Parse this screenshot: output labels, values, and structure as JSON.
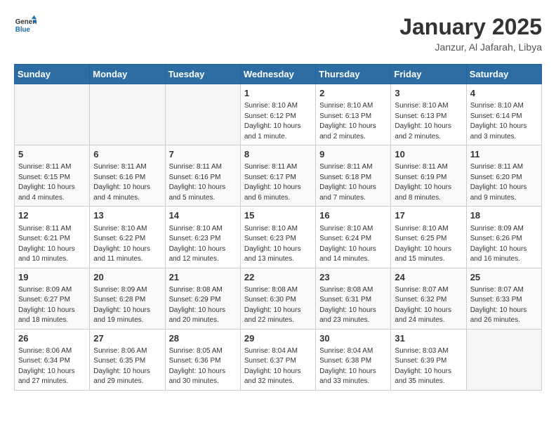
{
  "header": {
    "logo_line1": "General",
    "logo_line2": "Blue",
    "title": "January 2025",
    "subtitle": "Janzur, Al Jafarah, Libya"
  },
  "days_of_week": [
    "Sunday",
    "Monday",
    "Tuesday",
    "Wednesday",
    "Thursday",
    "Friday",
    "Saturday"
  ],
  "weeks": [
    {
      "row_class": "row-odd",
      "days": [
        {
          "num": "",
          "info": "",
          "empty": true
        },
        {
          "num": "",
          "info": "",
          "empty": true
        },
        {
          "num": "",
          "info": "",
          "empty": true
        },
        {
          "num": "1",
          "info": "Sunrise: 8:10 AM\nSunset: 6:12 PM\nDaylight: 10 hours\nand 1 minute.",
          "empty": false
        },
        {
          "num": "2",
          "info": "Sunrise: 8:10 AM\nSunset: 6:13 PM\nDaylight: 10 hours\nand 2 minutes.",
          "empty": false
        },
        {
          "num": "3",
          "info": "Sunrise: 8:10 AM\nSunset: 6:13 PM\nDaylight: 10 hours\nand 2 minutes.",
          "empty": false
        },
        {
          "num": "4",
          "info": "Sunrise: 8:10 AM\nSunset: 6:14 PM\nDaylight: 10 hours\nand 3 minutes.",
          "empty": false
        }
      ]
    },
    {
      "row_class": "row-even",
      "days": [
        {
          "num": "5",
          "info": "Sunrise: 8:11 AM\nSunset: 6:15 PM\nDaylight: 10 hours\nand 4 minutes.",
          "empty": false
        },
        {
          "num": "6",
          "info": "Sunrise: 8:11 AM\nSunset: 6:16 PM\nDaylight: 10 hours\nand 4 minutes.",
          "empty": false
        },
        {
          "num": "7",
          "info": "Sunrise: 8:11 AM\nSunset: 6:16 PM\nDaylight: 10 hours\nand 5 minutes.",
          "empty": false
        },
        {
          "num": "8",
          "info": "Sunrise: 8:11 AM\nSunset: 6:17 PM\nDaylight: 10 hours\nand 6 minutes.",
          "empty": false
        },
        {
          "num": "9",
          "info": "Sunrise: 8:11 AM\nSunset: 6:18 PM\nDaylight: 10 hours\nand 7 minutes.",
          "empty": false
        },
        {
          "num": "10",
          "info": "Sunrise: 8:11 AM\nSunset: 6:19 PM\nDaylight: 10 hours\nand 8 minutes.",
          "empty": false
        },
        {
          "num": "11",
          "info": "Sunrise: 8:11 AM\nSunset: 6:20 PM\nDaylight: 10 hours\nand 9 minutes.",
          "empty": false
        }
      ]
    },
    {
      "row_class": "row-odd",
      "days": [
        {
          "num": "12",
          "info": "Sunrise: 8:11 AM\nSunset: 6:21 PM\nDaylight: 10 hours\nand 10 minutes.",
          "empty": false
        },
        {
          "num": "13",
          "info": "Sunrise: 8:10 AM\nSunset: 6:22 PM\nDaylight: 10 hours\nand 11 minutes.",
          "empty": false
        },
        {
          "num": "14",
          "info": "Sunrise: 8:10 AM\nSunset: 6:23 PM\nDaylight: 10 hours\nand 12 minutes.",
          "empty": false
        },
        {
          "num": "15",
          "info": "Sunrise: 8:10 AM\nSunset: 6:23 PM\nDaylight: 10 hours\nand 13 minutes.",
          "empty": false
        },
        {
          "num": "16",
          "info": "Sunrise: 8:10 AM\nSunset: 6:24 PM\nDaylight: 10 hours\nand 14 minutes.",
          "empty": false
        },
        {
          "num": "17",
          "info": "Sunrise: 8:10 AM\nSunset: 6:25 PM\nDaylight: 10 hours\nand 15 minutes.",
          "empty": false
        },
        {
          "num": "18",
          "info": "Sunrise: 8:09 AM\nSunset: 6:26 PM\nDaylight: 10 hours\nand 16 minutes.",
          "empty": false
        }
      ]
    },
    {
      "row_class": "row-even",
      "days": [
        {
          "num": "19",
          "info": "Sunrise: 8:09 AM\nSunset: 6:27 PM\nDaylight: 10 hours\nand 18 minutes.",
          "empty": false
        },
        {
          "num": "20",
          "info": "Sunrise: 8:09 AM\nSunset: 6:28 PM\nDaylight: 10 hours\nand 19 minutes.",
          "empty": false
        },
        {
          "num": "21",
          "info": "Sunrise: 8:08 AM\nSunset: 6:29 PM\nDaylight: 10 hours\nand 20 minutes.",
          "empty": false
        },
        {
          "num": "22",
          "info": "Sunrise: 8:08 AM\nSunset: 6:30 PM\nDaylight: 10 hours\nand 22 minutes.",
          "empty": false
        },
        {
          "num": "23",
          "info": "Sunrise: 8:08 AM\nSunset: 6:31 PM\nDaylight: 10 hours\nand 23 minutes.",
          "empty": false
        },
        {
          "num": "24",
          "info": "Sunrise: 8:07 AM\nSunset: 6:32 PM\nDaylight: 10 hours\nand 24 minutes.",
          "empty": false
        },
        {
          "num": "25",
          "info": "Sunrise: 8:07 AM\nSunset: 6:33 PM\nDaylight: 10 hours\nand 26 minutes.",
          "empty": false
        }
      ]
    },
    {
      "row_class": "row-odd",
      "days": [
        {
          "num": "26",
          "info": "Sunrise: 8:06 AM\nSunset: 6:34 PM\nDaylight: 10 hours\nand 27 minutes.",
          "empty": false
        },
        {
          "num": "27",
          "info": "Sunrise: 8:06 AM\nSunset: 6:35 PM\nDaylight: 10 hours\nand 29 minutes.",
          "empty": false
        },
        {
          "num": "28",
          "info": "Sunrise: 8:05 AM\nSunset: 6:36 PM\nDaylight: 10 hours\nand 30 minutes.",
          "empty": false
        },
        {
          "num": "29",
          "info": "Sunrise: 8:04 AM\nSunset: 6:37 PM\nDaylight: 10 hours\nand 32 minutes.",
          "empty": false
        },
        {
          "num": "30",
          "info": "Sunrise: 8:04 AM\nSunset: 6:38 PM\nDaylight: 10 hours\nand 33 minutes.",
          "empty": false
        },
        {
          "num": "31",
          "info": "Sunrise: 8:03 AM\nSunset: 6:39 PM\nDaylight: 10 hours\nand 35 minutes.",
          "empty": false
        },
        {
          "num": "",
          "info": "",
          "empty": true
        }
      ]
    }
  ]
}
